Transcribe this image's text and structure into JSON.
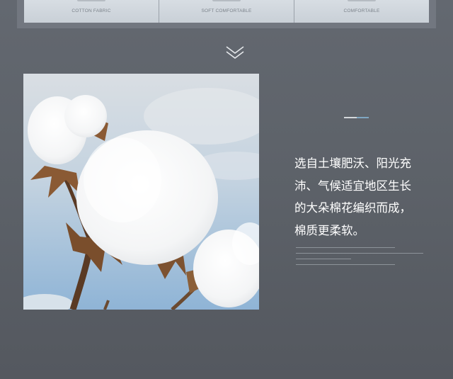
{
  "features": [
    {
      "label": "COTTON FABRIC"
    },
    {
      "label": "SOFT COMFORTABLE"
    },
    {
      "label": "COMFORTABLE"
    }
  ],
  "icons": {
    "chevron": "double-chevron-down-icon"
  },
  "description": {
    "lines": [
      "选自土壤肥沃、阳光充",
      "沛、气候适宜地区生长",
      "的大朵棉花编织而成，",
      "棉质更柔软。"
    ]
  },
  "colors": {
    "background": "#5d6269",
    "accent_light": "#d3d7db",
    "accent_blue": "#7fa6c2",
    "text": "#ffffff"
  }
}
